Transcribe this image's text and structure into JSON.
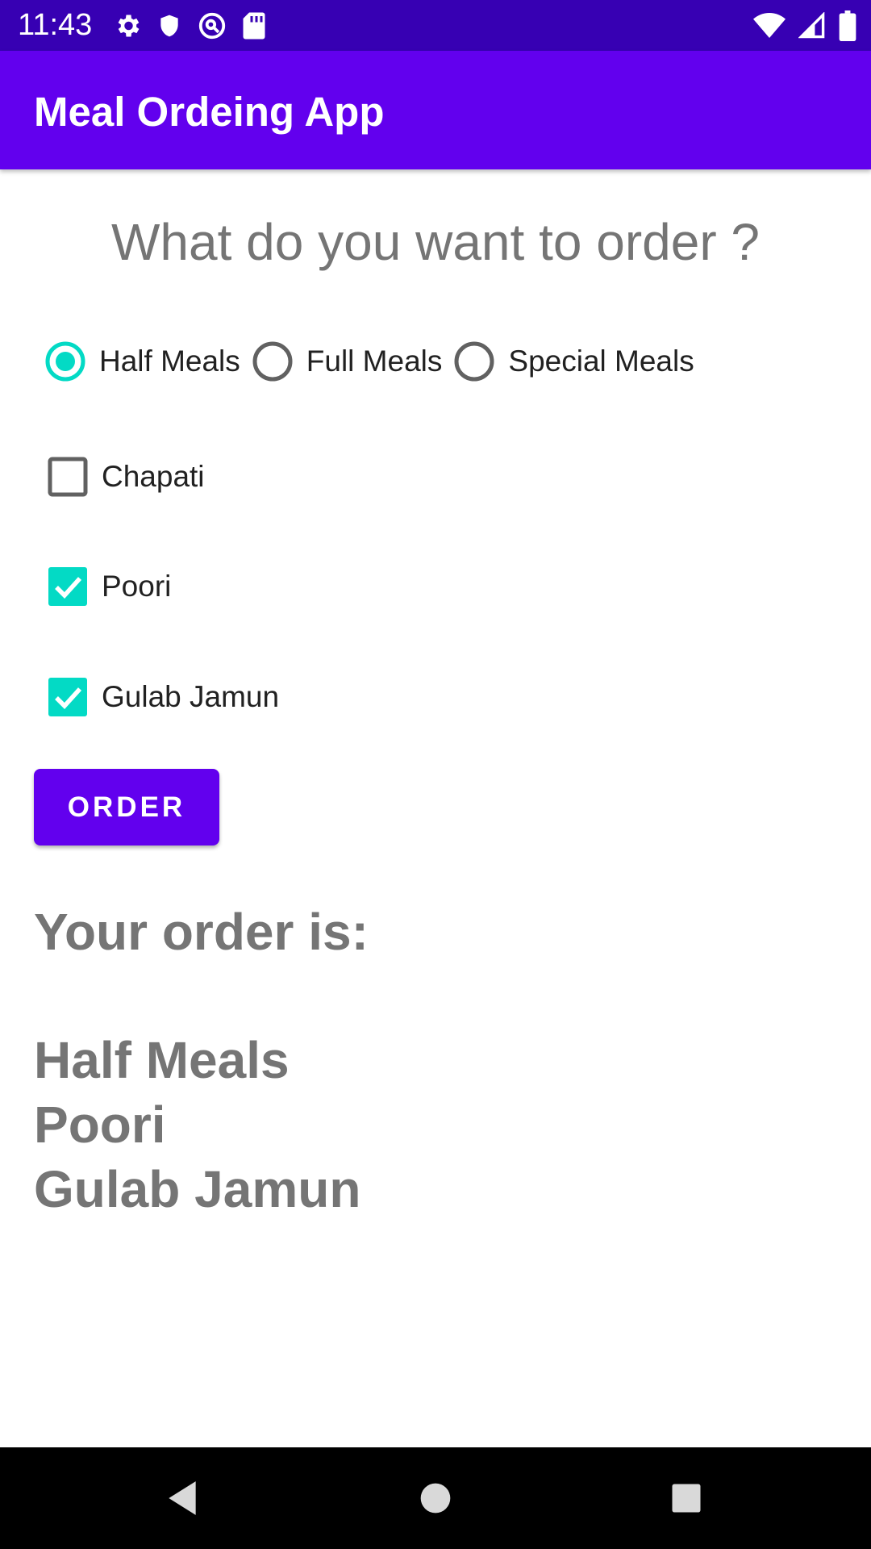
{
  "status_bar": {
    "time": "11:43",
    "left_icons": [
      "settings-icon",
      "shield-icon",
      "vpn-key-icon",
      "sd-card-icon"
    ],
    "right_icons": [
      "wifi-icon",
      "cell-signal-icon",
      "battery-icon"
    ],
    "background": "#3700b3"
  },
  "app_bar": {
    "title": "Meal Ordeing App",
    "background": "#6200ee"
  },
  "question": "What do you want to order ?",
  "meal_options": [
    {
      "label": "Half Meals",
      "selected": true
    },
    {
      "label": "Full Meals",
      "selected": false
    },
    {
      "label": "Special Meals",
      "selected": false
    }
  ],
  "extras": [
    {
      "label": "Chapati",
      "checked": false
    },
    {
      "label": "Poori",
      "checked": true
    },
    {
      "label": "Gulab Jamun",
      "checked": true
    }
  ],
  "order_button": {
    "label": "ORDER"
  },
  "result": {
    "heading": "Your order is:",
    "items": [
      "Half Meals",
      "Poori",
      "Gulab Jamun"
    ]
  },
  "nav_bar": {
    "icons": [
      "back-icon",
      "home-icon",
      "recents-icon"
    ]
  },
  "colors": {
    "accent": "#03dac5",
    "primary": "#6200ee",
    "primary_dark": "#3700b3",
    "text_secondary": "#757575"
  }
}
